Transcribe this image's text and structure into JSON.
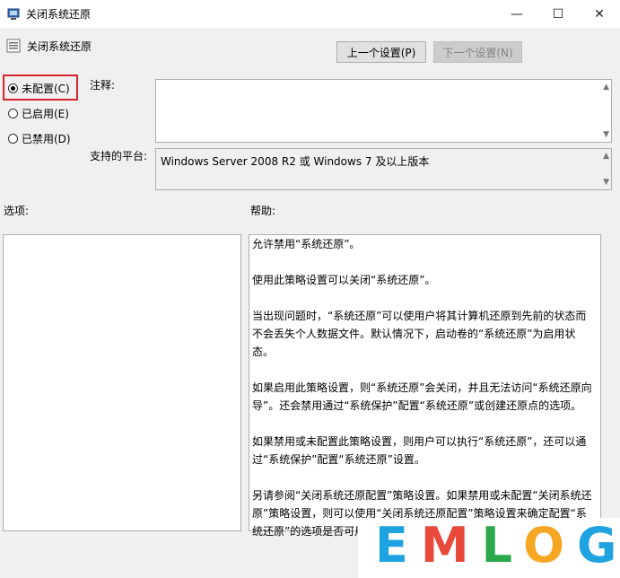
{
  "window": {
    "title": "关闭系统还原",
    "minimize_glyph": "—",
    "maximize_glyph": "☐",
    "close_glyph": "✕"
  },
  "header": {
    "policy_name": "关闭系统还原",
    "prev_button": "上一个设置(P)",
    "next_button": "下一个设置(N)"
  },
  "state": {
    "options": [
      {
        "label": "未配置(C)",
        "selected": true
      },
      {
        "label": "已启用(E)",
        "selected": false
      },
      {
        "label": "已禁用(D)",
        "selected": false
      }
    ]
  },
  "comment": {
    "label": "注释:",
    "value": ""
  },
  "platform": {
    "label": "支持的平台:",
    "value": "Windows Server 2008 R2 或 Windows 7 及以上版本"
  },
  "options_panel": {
    "label": "选项:"
  },
  "help_panel": {
    "label": "帮助:",
    "paragraphs": [
      "允许禁用“系统还原”。",
      "使用此策略设置可以关闭“系统还原”。",
      "当出现问题时，“系统还原”可以使用户将其计算机还原到先前的状态而不会丢失个人数据文件。默认情况下，启动卷的“系统还原”为启用状态。",
      "如果启用此策略设置，则“系统还原”会关闭，并且无法访问“系统还原向导”。还会禁用通过“系统保护”配置“系统还原”或创建还原点的选项。",
      "如果禁用或未配置此策略设置，则用户可以执行“系统还原”，还可以通过“系统保护”配置“系统还原”设置。",
      "另请参阅“关闭系统还原配置”策略设置。如果禁用或未配置“关闭系统还原”策略设置，则可以使用“关闭系统还原配置”策略设置来确定配置“系统还原”的选项是否可用。"
    ]
  },
  "watermark": {
    "letters": [
      "E",
      "M",
      "L",
      "O",
      "G"
    ],
    "colors": [
      "#1fa3e0",
      "#e8493a",
      "#2aa84a",
      "#f5a623",
      "#1fa3e0"
    ]
  }
}
